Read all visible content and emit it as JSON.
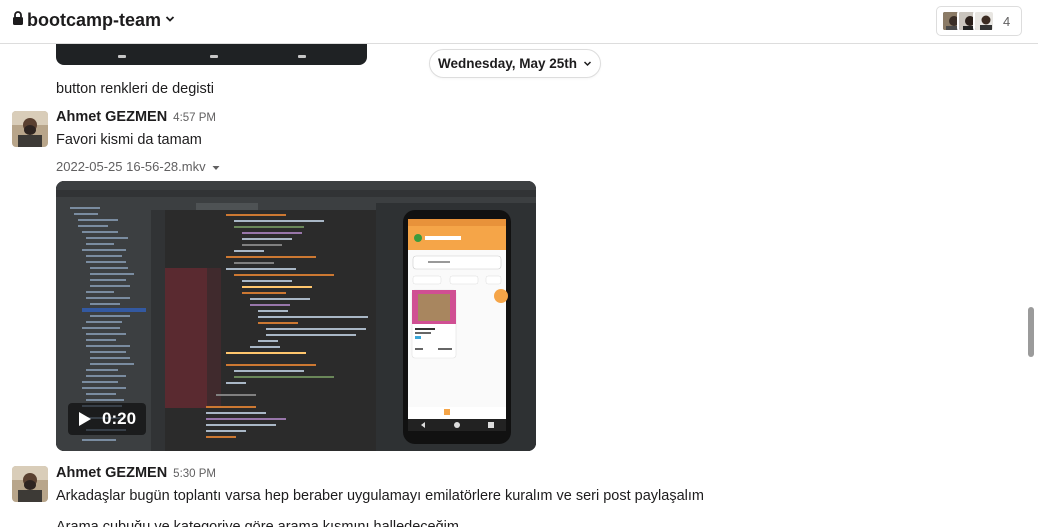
{
  "header": {
    "channel_name": "bootcamp-team",
    "member_count": "4",
    "lock_icon": "lock-icon",
    "chevron_icon": "chevron-down-icon"
  },
  "date_divider": {
    "label": "Wednesday, May 25th"
  },
  "messages": [
    {
      "text": "button renkleri de degisti"
    },
    {
      "author": "Ahmet GEZMEN",
      "time": "4:57 PM",
      "text": "Favori kismi da tamam",
      "file": {
        "name": "2022-05-25 16-56-28.mkv",
        "duration": "0:20"
      },
      "phone_app": {
        "title": "Ahmet GEZMEN",
        "tabs": [
          "Yeni",
          "Kampas",
          "Fav"
        ],
        "search_placeholder": "İstediğin ara"
      }
    },
    {
      "author": "Ahmet GEZMEN",
      "time": "5:30 PM",
      "text": "Arkadaşlar bugün toplantı varsa hep beraber uygulamayı emilatörlere kuralım ve seri post paylaşalım",
      "text2": "Arama çubuğu ve kategoriye göre arama kısmını halledeceğim"
    }
  ],
  "colors": {
    "accent_orange": "#f5a548",
    "ide_background": "#2b2b2b",
    "header_border": "#dddddd"
  }
}
